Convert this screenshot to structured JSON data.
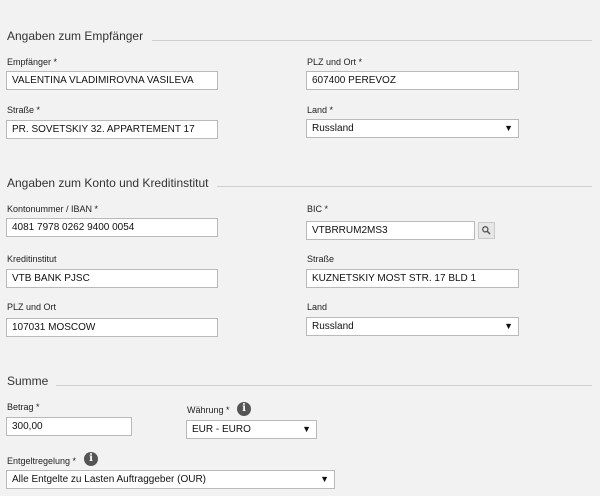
{
  "recipient": {
    "title": "Angaben zum Empfänger",
    "name_label": "Empfänger *",
    "name_value": "VALENTINA VLADIMIROVNA VASILEVA",
    "plz_label": "PLZ und Ort *",
    "plz_value": "607400 PEREVOZ",
    "street_label": "Straße *",
    "street_value": "PR. SOVETSKIY 32. APPARTEMENT 17",
    "country_label": "Land *",
    "country_value": "Russland"
  },
  "bank": {
    "title": "Angaben zum Konto und Kreditinstitut",
    "iban_label": "Kontonummer / IBAN *",
    "iban_value": "4081 7978 0262 9400 0054",
    "bic_label": "BIC *",
    "bic_value": "VTBRRUM2MS3",
    "institute_label": "Kreditinstitut",
    "institute_value": "VTB BANK PJSC",
    "street_label": "Straße",
    "street_value": "KUZNETSKIY MOST STR. 17 BLD 1",
    "plz_label": "PLZ und Ort",
    "plz_value": "107031 MOSCOW",
    "country_label": "Land",
    "country_value": "Russland"
  },
  "sum": {
    "title": "Summe",
    "amount_label": "Betrag *",
    "amount_value": "300,00",
    "currency_label": "Währung *",
    "currency_value": "EUR - EURO",
    "fee_label": "Entgeltregelung *",
    "fee_value": "Alle Entgelte zu Lasten Auftraggeber (OUR)"
  },
  "icons": {
    "info": "i",
    "dropdown": "▼"
  }
}
